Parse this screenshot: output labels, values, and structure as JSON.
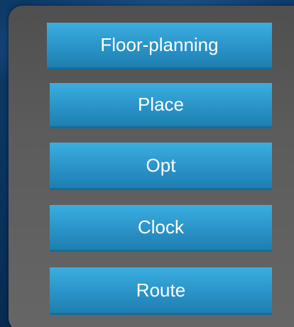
{
  "steps": [
    {
      "label": "Floor-planning"
    },
    {
      "label": "Place"
    },
    {
      "label": "Opt"
    },
    {
      "label": "Clock"
    },
    {
      "label": "Route"
    }
  ],
  "colors": {
    "background": "#0a3360",
    "panel": "#5c5c5c",
    "box": "#2a93c8",
    "text": "#ffffff"
  }
}
